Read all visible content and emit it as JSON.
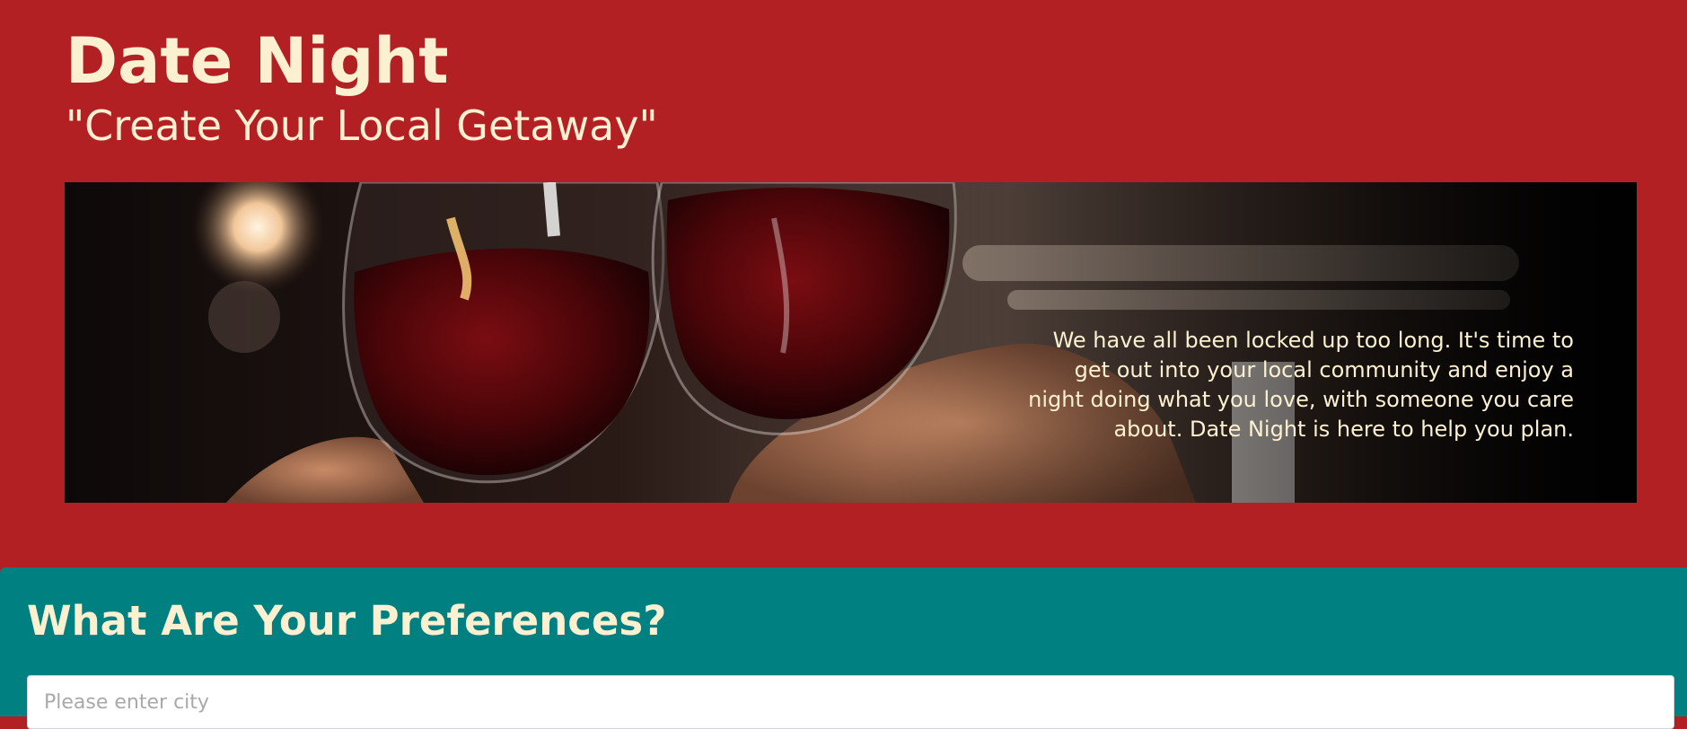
{
  "header": {
    "title": "Date Night",
    "tagline": "\"Create Your Local Getaway\""
  },
  "hero": {
    "image_description_icon": "wine-glasses-photo",
    "text": "We have all been locked up too long. It's time to get out into your local community and enjoy a night doing what you love, with someone you care about. Date Night is here to help you plan."
  },
  "preferences": {
    "title": "What Are Your Preferences?",
    "city_placeholder": "Please enter city",
    "city_value": ""
  },
  "colors": {
    "header_bg": "#b22024",
    "section_bg": "#008080",
    "text_cream": "#fbf0cf"
  }
}
